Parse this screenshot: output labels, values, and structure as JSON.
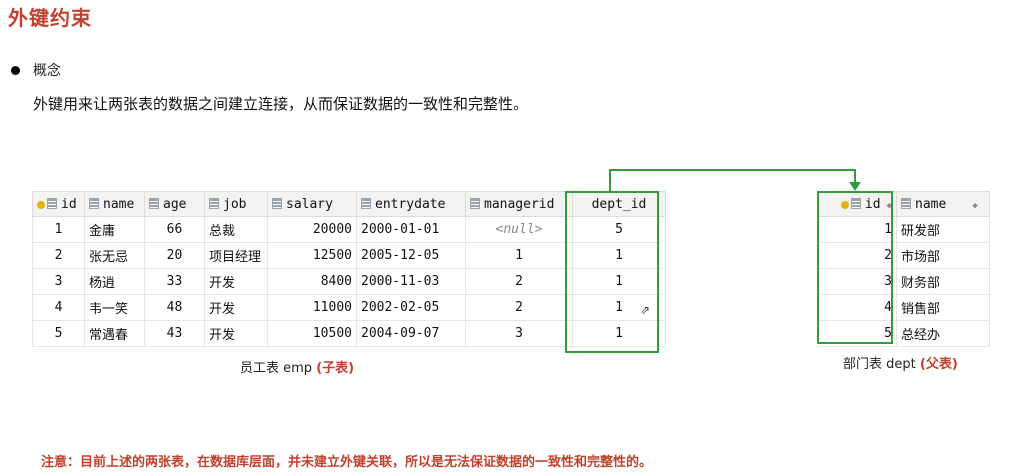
{
  "title": "外键约束",
  "concept": {
    "label": "概念",
    "text": "外键用来让两张表的数据之间建立连接，从而保证数据的一致性和完整性。"
  },
  "emp": {
    "headers": [
      "id",
      "name",
      "age",
      "job",
      "salary",
      "entrydate",
      "managerid",
      "dept_id"
    ],
    "rows": [
      [
        "1",
        "金庸",
        "66",
        "总裁",
        "20000",
        "2000-01-01",
        "<null>",
        "5"
      ],
      [
        "2",
        "张无忌",
        "20",
        "项目经理",
        "12500",
        "2005-12-05",
        "1",
        "1"
      ],
      [
        "3",
        "杨逍",
        "33",
        "开发",
        "8400",
        "2000-11-03",
        "2",
        "1"
      ],
      [
        "4",
        "韦一笑",
        "48",
        "开发",
        "11000",
        "2002-02-05",
        "2",
        "1"
      ],
      [
        "5",
        "常遇春",
        "43",
        "开发",
        "10500",
        "2004-09-07",
        "3",
        "1"
      ]
    ],
    "caption": "员工表 emp",
    "caption_tag": "(子表)"
  },
  "dept": {
    "headers": [
      "id",
      "name"
    ],
    "rows": [
      [
        "1",
        "研发部"
      ],
      [
        "2",
        "市场部"
      ],
      [
        "3",
        "财务部"
      ],
      [
        "4",
        "销售部"
      ],
      [
        "5",
        "总经办"
      ]
    ],
    "caption": "部门表 dept",
    "caption_tag": "(父表)"
  },
  "note": "注意：目前上述的两张表，在数据库层面，并未建立外键关联，所以是无法保证数据的一致性和完整性的。",
  "colors": {
    "accent": "#c1412f",
    "highlight": "#2e9d3a"
  }
}
